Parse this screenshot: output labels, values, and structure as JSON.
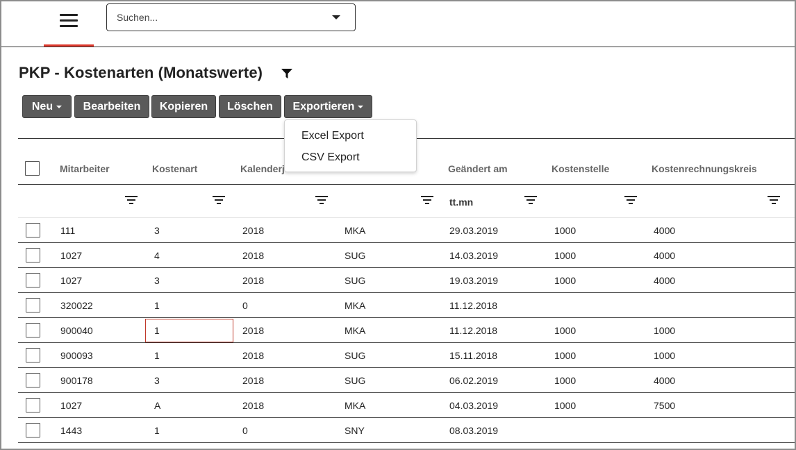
{
  "search": {
    "placeholder": "Suchen..."
  },
  "page": {
    "title": "PKP - Kostenarten (Monatswerte)"
  },
  "toolbar": {
    "buttons": [
      {
        "label": "Neu",
        "has_caret": true
      },
      {
        "label": "Bearbeiten",
        "has_caret": false
      },
      {
        "label": "Kopieren",
        "has_caret": false
      },
      {
        "label": "Löschen",
        "has_caret": false
      },
      {
        "label": "Exportieren",
        "has_caret": true
      }
    ]
  },
  "export_menu": {
    "items": [
      "Excel Export",
      "CSV Export"
    ]
  },
  "table": {
    "columns": [
      "Mitarbeiter",
      "Kostenart",
      "Kalenderj",
      "",
      "Geändert am",
      "Kostenstelle",
      "Kostenrechnungskreis"
    ],
    "date_filter_placeholder": "tt.mn",
    "rows": [
      [
        "111",
        "3",
        "2018",
        "MKA",
        "29.03.2019",
        "1000",
        "4000"
      ],
      [
        "1027",
        "4",
        "2018",
        "SUG",
        "14.03.2019",
        "1000",
        "4000"
      ],
      [
        "1027",
        "3",
        "2018",
        "SUG",
        "19.03.2019",
        "1000",
        "4000"
      ],
      [
        "320022",
        "1",
        "0",
        "MKA",
        "11.12.2018",
        "",
        ""
      ],
      [
        "900040",
        "1",
        "2018",
        "MKA",
        "11.12.2018",
        "1000",
        "1000"
      ],
      [
        "900093",
        "1",
        "2018",
        "SUG",
        "15.11.2018",
        "1000",
        "1000"
      ],
      [
        "900178",
        "3",
        "2018",
        "SUG",
        "06.02.2019",
        "1000",
        "4000"
      ],
      [
        "1027",
        "A",
        "2018",
        "MKA",
        "04.03.2019",
        "1000",
        "7500"
      ],
      [
        "1443",
        "1",
        "0",
        "SNY",
        "08.03.2019",
        "",
        ""
      ]
    ]
  },
  "colors": {
    "accent": "#e03a2e",
    "button_bg": "#5a5a5a",
    "selection_border": "#c0392b"
  }
}
